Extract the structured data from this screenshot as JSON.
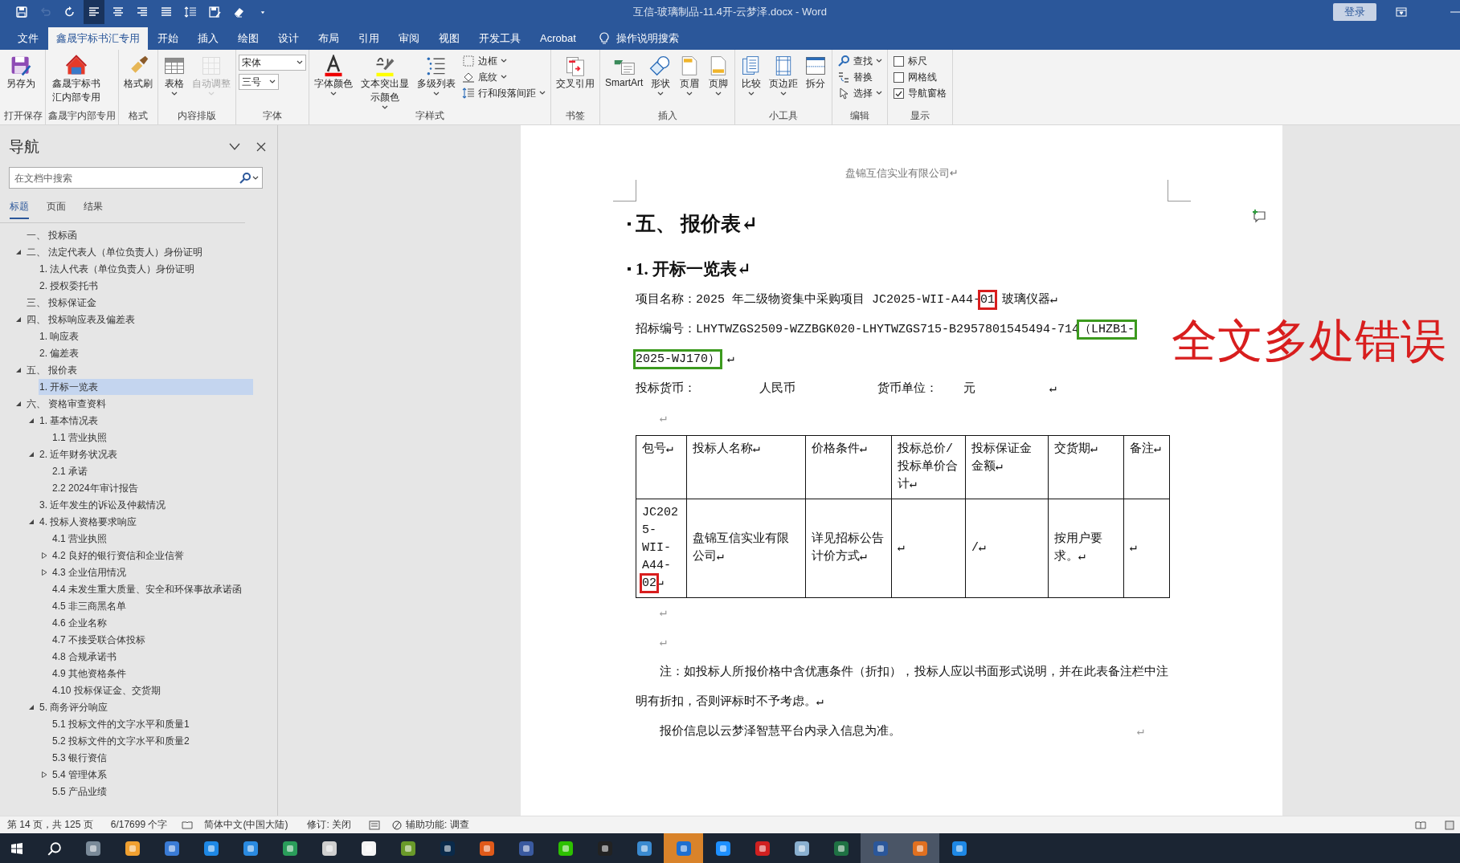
{
  "window": {
    "title": "互信-玻璃制品-11.4开-云梦泽.docx  -  Word",
    "sign_in": "登录"
  },
  "quick_access": [
    {
      "on": false,
      "disabled": false
    },
    {
      "on": false,
      "disabled": true
    },
    {
      "on": false,
      "disabled": false
    },
    {
      "on": true,
      "disabled": false
    },
    {
      "on": false,
      "disabled": false
    },
    {
      "on": false,
      "disabled": false
    },
    {
      "on": false,
      "disabled": false
    },
    {
      "on": false,
      "disabled": false
    },
    {
      "on": false,
      "disabled": false
    },
    {
      "on": false,
      "disabled": false
    }
  ],
  "menu_tabs": [
    {
      "label": "文件",
      "selected": false
    },
    {
      "label": "鑫晟宇标书汇专用",
      "selected": true
    },
    {
      "label": "开始",
      "selected": false
    },
    {
      "label": "插入",
      "selected": false
    },
    {
      "label": "绘图",
      "selected": false
    },
    {
      "label": "设计",
      "selected": false
    },
    {
      "label": "布局",
      "selected": false
    },
    {
      "label": "引用",
      "selected": false
    },
    {
      "label": "审阅",
      "selected": false
    },
    {
      "label": "视图",
      "selected": false
    },
    {
      "label": "开发工具",
      "selected": false
    },
    {
      "label": "Acrobat",
      "selected": false
    }
  ],
  "tell_me": "操作说明搜索",
  "ribbon_groups": [
    {
      "label": "打开保存",
      "items": [
        {
          "kind": "large",
          "label": "另存为",
          "dropdown": false,
          "disabled": false
        }
      ]
    },
    {
      "label": "鑫晟宇内部专用",
      "items": [
        {
          "kind": "large",
          "label": "鑫晟宇标书汇内部专用",
          "dropdown": false,
          "disabled": false
        }
      ]
    },
    {
      "label": "格式",
      "items": [
        {
          "kind": "large",
          "label": "格式刷",
          "dropdown": false,
          "disabled": false
        }
      ]
    },
    {
      "label": "内容排版",
      "items": [
        {
          "kind": "large",
          "label": "表格",
          "dropdown": true,
          "disabled": false
        },
        {
          "kind": "large",
          "label": "自动调整",
          "dropdown": true,
          "disabled": true
        }
      ]
    },
    {
      "label": "字体",
      "items": [
        {
          "kind": "combo",
          "value": "宋体"
        },
        {
          "kind": "combo",
          "value": "三号"
        }
      ]
    },
    {
      "label": "字样式",
      "items": [
        {
          "kind": "large",
          "label": "字体颜色",
          "dropdown": true,
          "disabled": false
        },
        {
          "kind": "large",
          "label": "文本突出显示颜色",
          "dropdown": true,
          "disabled": false
        },
        {
          "kind": "large",
          "label": "多级列表",
          "dropdown": true,
          "disabled": false
        },
        {
          "kind": "small",
          "label": "边框",
          "dropdown": true
        },
        {
          "kind": "small",
          "label": "底纹",
          "dropdown": true
        },
        {
          "kind": "small",
          "label": "行和段落间距",
          "dropdown": true
        }
      ]
    },
    {
      "label": "书签",
      "items": [
        {
          "kind": "large",
          "label": "交叉引用",
          "dropdown": false,
          "disabled": false
        }
      ]
    },
    {
      "label": "插入",
      "items": [
        {
          "kind": "large",
          "label": "SmartArt",
          "dropdown": false,
          "disabled": false
        },
        {
          "kind": "large",
          "label": "形状",
          "dropdown": true,
          "disabled": false
        },
        {
          "kind": "large",
          "label": "页眉",
          "dropdown": true,
          "disabled": false
        },
        {
          "kind": "large",
          "label": "页脚",
          "dropdown": true,
          "disabled": false
        }
      ]
    },
    {
      "label": "小工具",
      "items": [
        {
          "kind": "large",
          "label": "比较",
          "dropdown": true,
          "disabled": false
        },
        {
          "kind": "large",
          "label": "页边距",
          "dropdown": true,
          "disabled": false
        },
        {
          "kind": "large",
          "label": "拆分",
          "dropdown": false,
          "disabled": false
        }
      ]
    },
    {
      "label": "编辑",
      "items": [
        {
          "kind": "small",
          "label": "查找",
          "dropdown": true
        },
        {
          "kind": "small",
          "label": "替换",
          "dropdown": false
        },
        {
          "kind": "small",
          "label": "选择",
          "dropdown": true
        }
      ]
    },
    {
      "label": "显示",
      "items": [
        {
          "kind": "checkbox",
          "label": "标尺",
          "checked": false
        },
        {
          "kind": "checkbox",
          "label": "网格线",
          "checked": false
        },
        {
          "kind": "checkbox",
          "label": "导航窗格",
          "checked": true
        }
      ]
    }
  ],
  "navigation": {
    "title": "导航",
    "search": {
      "placeholder": "在文档中搜索"
    },
    "tabs": [
      {
        "label": "标题",
        "selected": true
      },
      {
        "label": "页面",
        "selected": false
      },
      {
        "label": "结果",
        "selected": false
      }
    ],
    "headings": [
      {
        "label": "一、 投标函",
        "selected": false
      },
      {
        "label": "二、 法定代表人（单位负责人）身份证明",
        "selected": false,
        "expanded": true,
        "children": [
          {
            "label": "1. 法人代表（单位负责人）身份证明",
            "selected": false
          },
          {
            "label": "2. 授权委托书",
            "selected": false
          }
        ]
      },
      {
        "label": "三、 投标保证金",
        "selected": false
      },
      {
        "label": "四、 投标响应表及偏差表",
        "selected": false,
        "expanded": true,
        "children": [
          {
            "label": "1. 响应表",
            "selected": false
          },
          {
            "label": "2. 偏差表",
            "selected": false
          }
        ]
      },
      {
        "label": "五、 报价表",
        "selected": false,
        "expanded": true,
        "children": [
          {
            "label": "1. 开标一览表",
            "selected": true
          }
        ]
      },
      {
        "label": "六、 资格审查资料",
        "selected": false,
        "expanded": true,
        "children": [
          {
            "label": "1. 基本情况表",
            "selected": false,
            "expanded": true,
            "children": [
              {
                "label": "1.1 营业执照",
                "selected": false
              }
            ]
          },
          {
            "label": "2. 近年财务状况表",
            "selected": false,
            "expanded": true,
            "children": [
              {
                "label": "2.1 承诺",
                "selected": false
              },
              {
                "label": "2.2 2024年审计报告",
                "selected": false
              }
            ]
          },
          {
            "label": "3. 近年发生的诉讼及仲裁情况",
            "selected": false
          },
          {
            "label": "4. 投标人资格要求响应",
            "selected": false,
            "expanded": true,
            "children": [
              {
                "label": "4.1 营业执照",
                "selected": false
              },
              {
                "label": "4.2 良好的银行资信和企业信誉",
                "selected": false,
                "expanded": false
              },
              {
                "label": "4.3 企业信用情况",
                "selected": false,
                "expanded": false
              },
              {
                "label": "4.4 未发生重大质量、安全和环保事故承诺函",
                "selected": false
              },
              {
                "label": "4.5 非三商黑名单",
                "selected": false
              },
              {
                "label": "4.6 企业名称",
                "selected": false
              },
              {
                "label": "4.7 不接受联合体投标",
                "selected": false
              },
              {
                "label": "4.8 合规承诺书",
                "selected": false
              },
              {
                "label": "4.9 其他资格条件",
                "selected": false
              },
              {
                "label": "4.10 投标保证金、交货期",
                "selected": false
              }
            ]
          },
          {
            "label": "5. 商务评分响应",
            "selected": false,
            "expanded": true,
            "children": [
              {
                "label": "5.1 投标文件的文字水平和质量1",
                "selected": false
              },
              {
                "label": "5.2 投标文件的文字水平和质量2",
                "selected": false
              },
              {
                "label": "5.3 银行资信",
                "selected": false
              },
              {
                "label": "5.4 管理体系",
                "selected": false,
                "expanded": false
              },
              {
                "label": "5.5 产品业绩",
                "selected": false
              }
            ]
          }
        ]
      }
    ]
  },
  "document": {
    "header": "盘锦互信实业有限公司↵",
    "heading_1": "五、 报价表↵",
    "heading_2": "1. 开标一览表↵",
    "paragraphs": [
      {
        "kind": "plain",
        "runs": [
          {
            "text": "项目名称：2025 年二级物资集中采购项目 JC2025-WII-A44-"
          },
          {
            "text": "01",
            "color": "#d81e1e"
          },
          {
            "text": " 玻璃仪器↵"
          }
        ]
      },
      {
        "kind": "plain",
        "runs": [
          {
            "text": "招标编号：LHYTWZGS2509-WZZBGK020-LHYTWZGS715-B2957801545494-714"
          },
          {
            "text": "（LHZB1-2025-WJ170）",
            "color": "#3c9a1e"
          },
          {
            "text": " ↵"
          }
        ]
      }
    ],
    "currency": [
      "投标货币：",
      "人民币",
      "货币单位：",
      "元",
      "↵"
    ],
    "blank_before_table": "↵",
    "table": {
      "columns": [
        "包号↵",
        "投标人名称↵",
        "价格条件↵",
        "投标总价/投标单价合计↵",
        "投标保证金金额↵",
        "交货期↵",
        "备注↵"
      ],
      "rows": [
        [
          {
            "runs": [
              {
                "text": "JC2025-WII-A44-"
              },
              {
                "text": "02",
                "color": "#d81e1e"
              },
              {
                "text": "↵"
              }
            ]
          },
          {
            "runs": [
              {
                "text": "盘锦互信实业有限公司↵"
              }
            ]
          },
          {
            "runs": [
              {
                "text": "详见招标公告计价方式↵"
              }
            ]
          },
          {
            "runs": [
              {
                "text": "↵"
              }
            ]
          },
          {
            "runs": [
              {
                "text": "/↵"
              }
            ]
          },
          {
            "runs": [
              {
                "text": "按用户要求。↵"
              }
            ]
          },
          {
            "runs": [
              {
                "text": "↵"
              }
            ]
          }
        ]
      ]
    },
    "after_table": [
      "↵",
      "↵"
    ],
    "notes": [
      "注：如投标人所报价格中含优惠条件（折扣），投标人应以书面形式说明，并在此表备注栏中注明有折扣，否则评标时不予考虑。↵",
      "报价信息以云梦泽智慧平台内录入信息为准。"
    ],
    "last_mark": "↵",
    "annotation": "全文多处错误"
  },
  "status_bar": {
    "page": "第 14 页，共 125 页",
    "words": "6/17699 个字",
    "language": "简体中文(中国大陆)",
    "track_changes": "修订: 关闭",
    "accessibility": "辅助功能: 调查"
  },
  "taskbar": {
    "apps": [
      {
        "color": "#7a8a99",
        "active": false,
        "flash": false
      },
      {
        "color": "#f0a030",
        "active": false,
        "flash": false
      },
      {
        "color": "#3a7bd5",
        "active": false,
        "flash": false
      },
      {
        "color": "#1e88e5",
        "active": false,
        "flash": false
      },
      {
        "color": "#2a8ae0",
        "active": false,
        "flash": false
      },
      {
        "color": "#2a9d5a",
        "active": false,
        "flash": false
      },
      {
        "color": "#cfcfcf",
        "active": false,
        "flash": false
      },
      {
        "color": "#f4f4f4",
        "active": false,
        "flash": false
      },
      {
        "color": "#6a9a2a",
        "active": false,
        "flash": false
      },
      {
        "color": "#0a2a4a",
        "active": false,
        "flash": false
      },
      {
        "color": "#e05a1a",
        "active": false,
        "flash": false
      },
      {
        "color": "#3a5aa0",
        "active": false,
        "flash": false
      },
      {
        "color": "#2dc100",
        "active": false,
        "flash": false
      },
      {
        "color": "#222222",
        "active": false,
        "flash": false
      },
      {
        "color": "#3a8ad0",
        "active": false,
        "flash": false
      },
      {
        "color": "#1e6fd0",
        "active": false,
        "flash": true
      },
      {
        "color": "#1e90ff",
        "active": false,
        "flash": false
      },
      {
        "color": "#d02020",
        "active": false,
        "flash": false
      },
      {
        "color": "#8ab0d0",
        "active": false,
        "flash": false
      },
      {
        "color": "#1f7244",
        "active": false,
        "flash": false
      },
      {
        "color": "#2b579a",
        "active": true,
        "flash": false
      },
      {
        "color": "#e07020",
        "active": true,
        "flash": false
      },
      {
        "color": "#1e88e5",
        "active": false,
        "flash": false
      }
    ]
  }
}
